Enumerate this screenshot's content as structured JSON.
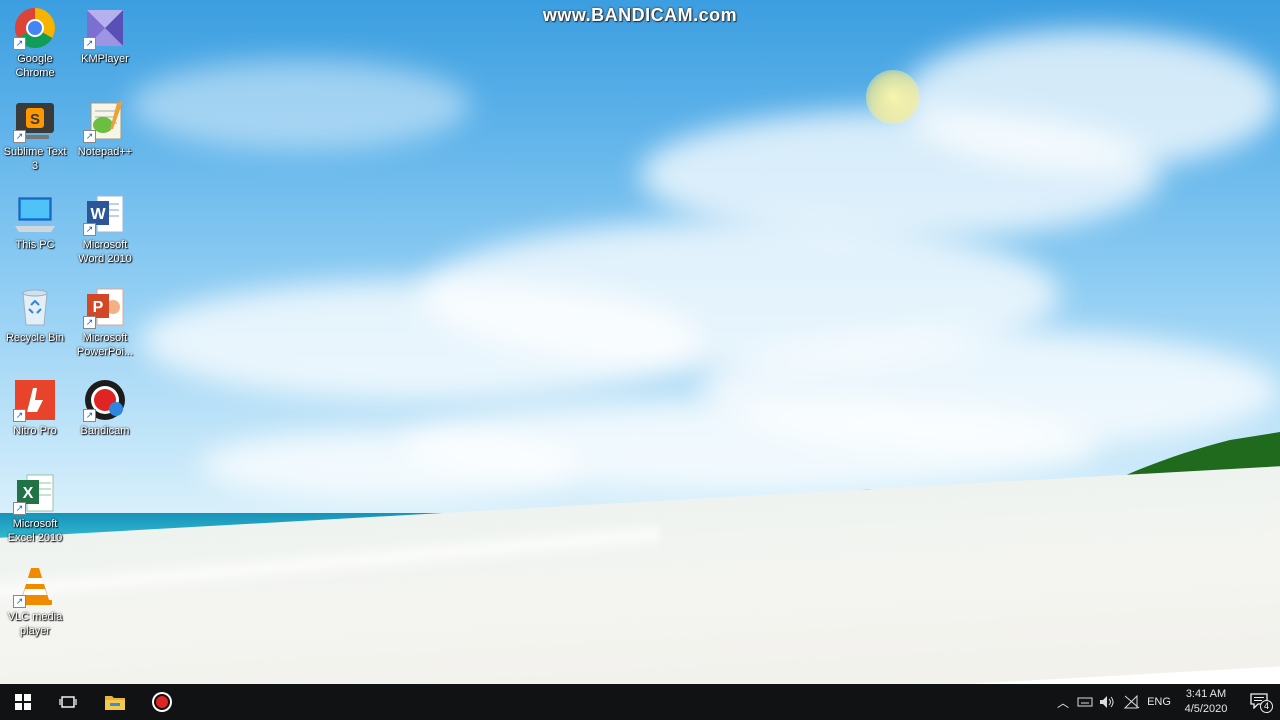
{
  "watermark": "www.BANDICAM.com",
  "desktop_icons": [
    {
      "label": "Google Chrome",
      "icon": "chrome-icon"
    },
    {
      "label": "KMPlayer",
      "icon": "kmplayer-icon"
    },
    {
      "label": "Sublime Text 3",
      "icon": "sublime-text-icon"
    },
    {
      "label": "Notepad++",
      "icon": "notepadpp-icon"
    },
    {
      "label": "This PC",
      "icon": "this-pc-icon"
    },
    {
      "label": "Microsoft Word 2010",
      "icon": "word-icon"
    },
    {
      "label": "Recycle Bin",
      "icon": "recycle-bin-icon"
    },
    {
      "label": "Microsoft PowerPoi...",
      "icon": "powerpoint-icon"
    },
    {
      "label": "Nitro Pro",
      "icon": "nitro-pro-icon"
    },
    {
      "label": "Bandicam",
      "icon": "bandicam-icon"
    },
    {
      "label": "Microsoft Excel 2010",
      "icon": "excel-icon"
    },
    {
      "label": "VLC media player",
      "icon": "vlc-icon"
    }
  ],
  "taskbar": {
    "start": "windows-start-icon",
    "task_view": "task-view-icon",
    "pinned": [
      "file-explorer-icon",
      "bandicam-record-icon"
    ],
    "tray": {
      "language": "ENG",
      "time": "3:41 AM",
      "date": "4/5/2020",
      "notification_count": "4"
    }
  },
  "colors": {
    "taskbar": "#101214",
    "sky_top": "#3b9ee0",
    "sea": "#2fb6cf",
    "sand": "#f2f2ee"
  }
}
